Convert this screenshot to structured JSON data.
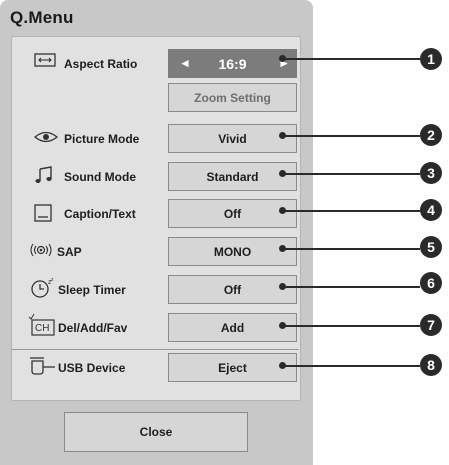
{
  "menu": {
    "title": "Q.Menu",
    "close_label": "Close",
    "items": [
      {
        "label": "Aspect Ratio",
        "value": "16:9",
        "icon": "aspect-ratio-icon",
        "left_arrow": "◄",
        "right_arrow": "►"
      },
      {
        "label": "",
        "value": "Zoom Setting",
        "icon": ""
      },
      {
        "label": "Picture Mode",
        "value": "Vivid",
        "icon": "eye-icon"
      },
      {
        "label": "Sound Mode",
        "value": "Standard",
        "icon": "music-note-icon"
      },
      {
        "label": "Caption/Text",
        "value": "Off",
        "icon": "caption-icon"
      },
      {
        "label": "SAP",
        "value": "MONO",
        "icon": "sap-icon"
      },
      {
        "label": "Sleep Timer",
        "value": "Off",
        "icon": "sleep-timer-icon"
      },
      {
        "label": "Del/Add/Fav",
        "value": "Add",
        "icon": "channel-icon",
        "icon_text": "CH"
      },
      {
        "label": "USB Device",
        "value": "Eject",
        "icon": "usb-icon"
      }
    ]
  },
  "callouts": [
    "1",
    "2",
    "3",
    "4",
    "5",
    "6",
    "7",
    "8"
  ],
  "colors": {
    "panel": "#c8c8c8",
    "inner": "#e1e1e1",
    "button": "#d6d6d6",
    "aspect_button": "#7c7c7c",
    "callout": "#2a2a2a"
  }
}
